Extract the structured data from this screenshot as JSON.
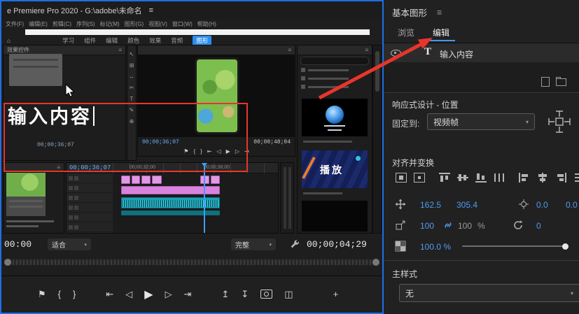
{
  "colors": {
    "accent_blue": "#3f9bfa",
    "annotation_red": "#e8352b",
    "clip_pink": "#e09ae4",
    "clip_teal": "#17a4b8",
    "selection_border": "#1f6fe8"
  },
  "titlebar": {
    "title": "e Premiere Pro 2020 - G:\\adobe\\未命名",
    "menu_glyph": "≡"
  },
  "menubar": {
    "items": [
      "文件(F)",
      "编辑(E)",
      "剪辑(C)",
      "序列(S)",
      "标记(M)",
      "图形(G)",
      "视图(V)",
      "窗口(W)",
      "帮助(H)"
    ]
  },
  "workspace": {
    "home_glyph": "⌂",
    "tabs": [
      "学习",
      "组件",
      "编辑",
      "颜色",
      "效果",
      "音频",
      "图形"
    ],
    "active": "图形"
  },
  "effects_panel": {
    "tab_label": "效果控件",
    "panel_menu_glyph": "≡",
    "canvas_text": "输入内容",
    "timecode": "00;00;36;07"
  },
  "tools": {
    "glyphs": [
      "↖",
      "⊞",
      "↔",
      "✂",
      "T",
      "✎",
      "⊕"
    ]
  },
  "program_monitor": {
    "panel_menu_glyph": "≡",
    "tc_current": "00;00;36;07",
    "tc_duration": "00;00;48;04",
    "transport_glyphs": [
      "⚑",
      "{",
      "}",
      "⇤",
      "◁",
      "▶",
      "▷",
      "⇥"
    ]
  },
  "project_panel": {
    "panel_menu_glyph": "≡",
    "thumb_play_label": "播放"
  },
  "bin_panel": {
    "panel_menu_glyph": "≡"
  },
  "timeline": {
    "tc": "00;00;36;07",
    "ruler_labels": [
      "00;00;32;00",
      "00;00;38;00"
    ]
  },
  "monitor_bar": {
    "tc_left": "00:00",
    "fit_label": "适合",
    "quality_label": "完整",
    "chevron": "▾",
    "tc_right": "00;00;04;29"
  },
  "transport": {
    "marker": "⚑",
    "mark_in": "{",
    "mark_out": "}",
    "go_in": "⇤",
    "step_back": "◁",
    "play": "▶",
    "step_fwd": "▷",
    "go_out": "⇥",
    "lift": "↥",
    "extract": "↧",
    "compare": "◫",
    "plus": "+"
  },
  "eg": {
    "title": "基本图形",
    "panel_menu_glyph": "≡",
    "tab_browse": "浏览",
    "tab_edit": "编辑",
    "layer": {
      "type_glyph": "T",
      "name": "输入内容"
    },
    "responsive_heading": "响应式设计 - 位置",
    "pin_label": "固定到:",
    "pin_value": "视频帧",
    "chevron": "▾",
    "align_heading": "对齐并变换",
    "position_x": "162.5",
    "position_y": "305.4",
    "anchor_x": "0.0",
    "anchor_y": "0.0",
    "scale_value": "100",
    "scale_linked": "100",
    "percent": "%",
    "rotation": "0",
    "opacity": "100.0 %",
    "master_heading": "主样式",
    "master_value": "无"
  }
}
